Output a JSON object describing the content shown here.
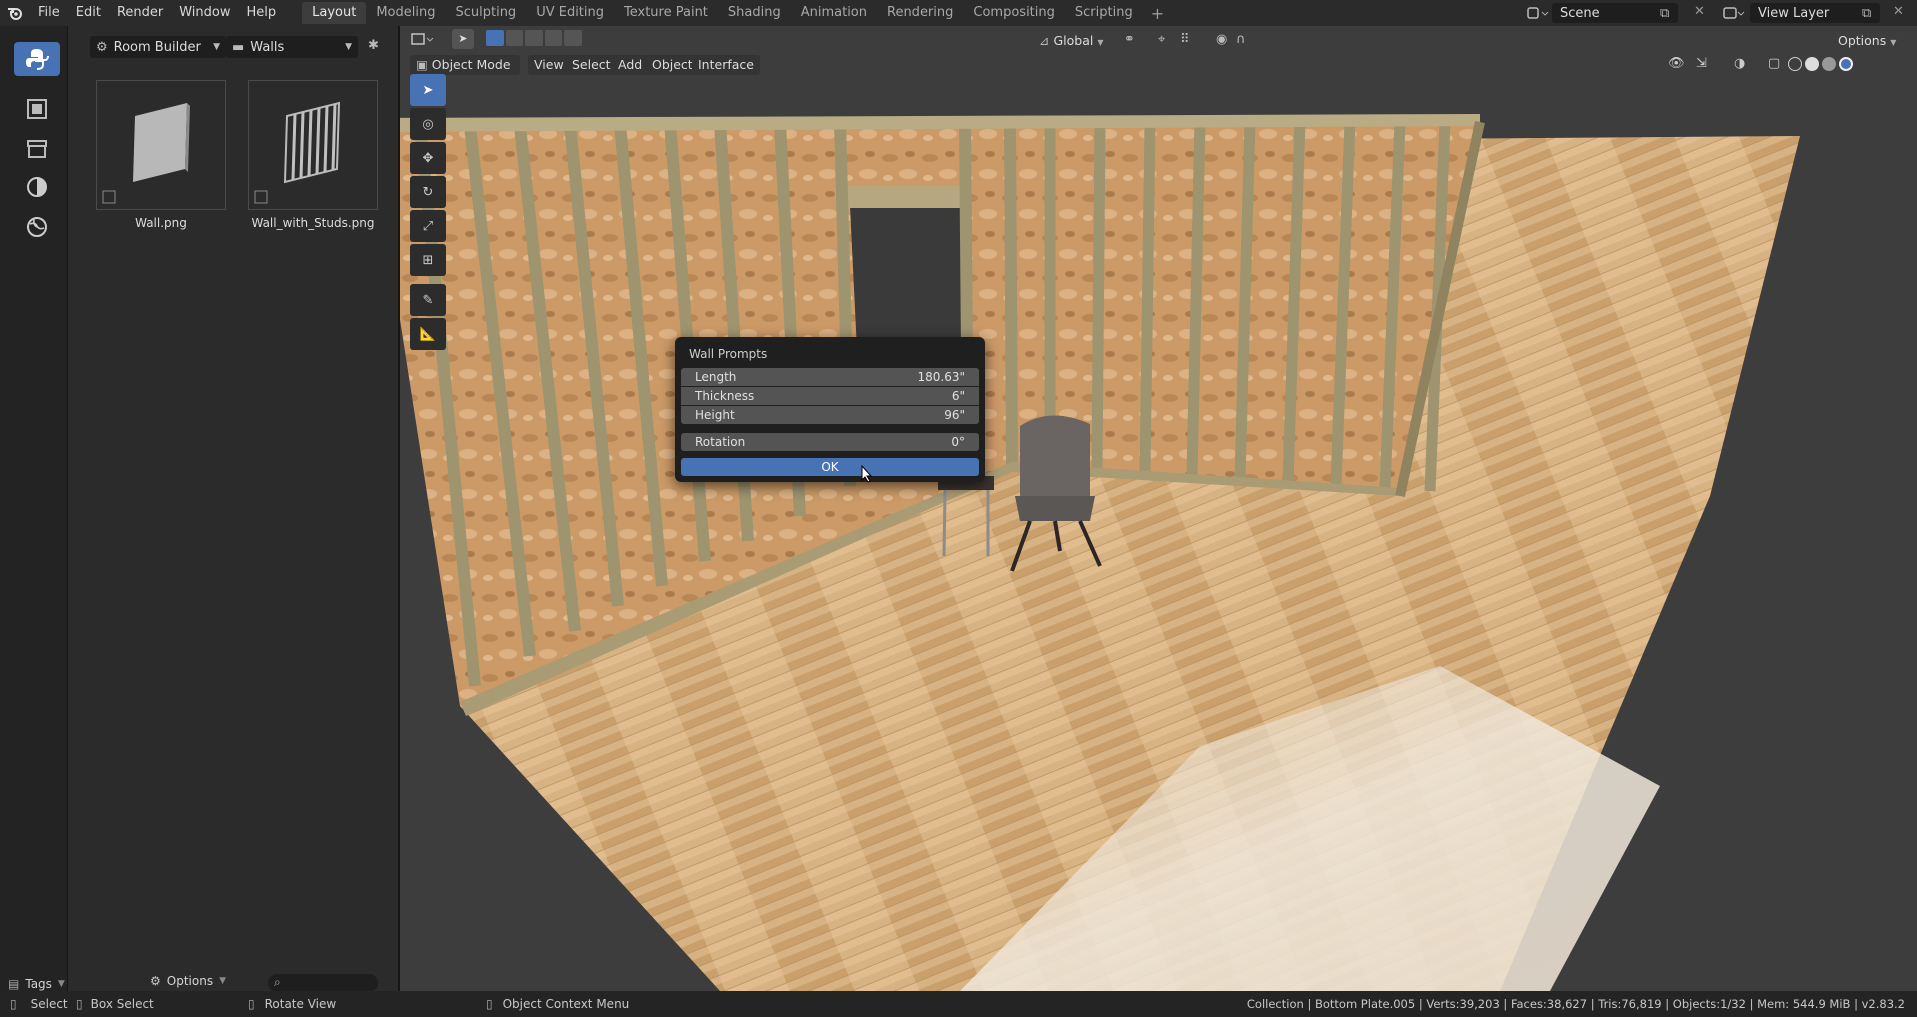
{
  "menu": [
    "File",
    "Edit",
    "Render",
    "Window",
    "Help"
  ],
  "workspace_tabs": [
    {
      "label": "Layout",
      "active": true
    },
    {
      "label": "Modeling"
    },
    {
      "label": "Sculpting"
    },
    {
      "label": "UV Editing"
    },
    {
      "label": "Texture Paint"
    },
    {
      "label": "Shading"
    },
    {
      "label": "Animation"
    },
    {
      "label": "Rendering"
    },
    {
      "label": "Compositing"
    },
    {
      "label": "Scripting"
    }
  ],
  "scene": {
    "name": "Scene",
    "view_layer": "View Layer"
  },
  "asset_browser": {
    "library": "Room Builder",
    "category": "Walls",
    "items": [
      {
        "label": "Wall.png",
        "icon": "wall-panel-icon"
      },
      {
        "label": "Wall_with_Studs.png",
        "icon": "wall-studs-icon"
      }
    ],
    "footer": {
      "tags": "Tags",
      "options": "Options"
    }
  },
  "viewport_header": {
    "mode": "Object Mode",
    "menus": [
      "View",
      "Select",
      "Add",
      "Object",
      "Interface"
    ],
    "orientation": "Global",
    "options": "Options"
  },
  "dialog": {
    "title": "Wall Prompts",
    "props": [
      {
        "label": "Length",
        "value": "180.63\""
      },
      {
        "label": "Thickness",
        "value": "6\""
      },
      {
        "label": "Height",
        "value": "96\""
      },
      {
        "label": "Rotation",
        "value": "0°"
      }
    ],
    "ok": "OK"
  },
  "statusbar": {
    "select": "Select",
    "box_select": "Box Select",
    "rotate": "Rotate View",
    "context": "Object Context Menu",
    "stats": "Collection | Bottom Plate.005 | Verts:39,203 | Faces:38,627 | Tris:76,819 | Objects:1/32 | Mem: 544.9 MiB | v2.83.2"
  },
  "colors": {
    "accent": "#4772b3",
    "panel": "#2b2b2b",
    "viewport": "#3d3d3d"
  }
}
